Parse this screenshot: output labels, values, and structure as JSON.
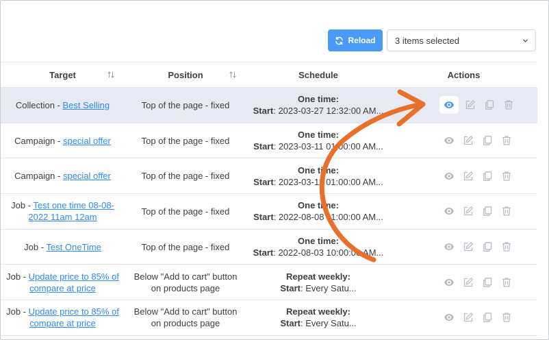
{
  "toolbar": {
    "reload_label": "Reload",
    "select_value": "3 items selected"
  },
  "columns": {
    "target": "Target",
    "position": "Position",
    "schedule": "Schedule",
    "actions": "Actions"
  },
  "rows": [
    {
      "prefix": "Collection - ",
      "link": "Best Selling",
      "position": "Top of the page - fixed",
      "sched_title": "One time:",
      "sched_key": "Start",
      "sched_val": ": 2023-03-27 12:32:00 AM...",
      "highlight": true
    },
    {
      "prefix": "Campaign - ",
      "link": "special offer",
      "position": "Top of the page - fixed",
      "sched_title": "One time:",
      "sched_key": "Start",
      "sched_val": ": 2023-03-11 01:00:00 AM..."
    },
    {
      "prefix": "Campaign - ",
      "link": "special offer",
      "position": "Top of the page - fixed",
      "sched_title": "One time:",
      "sched_key": "Start",
      "sched_val": ": 2023-03-11 01:00:00 AM..."
    },
    {
      "prefix": "Job - ",
      "link": "Test one time 08-08-2022 11am 12am",
      "position": "Top of the page - fixed",
      "sched_title": "One time:",
      "sched_key": "Start",
      "sched_val": ": 2022-08-08 11:00:00 AM..."
    },
    {
      "prefix": "Job - ",
      "link": "Test OneTime",
      "position": "Top of the page - fixed",
      "sched_title": "One time:",
      "sched_key": "Start",
      "sched_val": ": 2022-08-03 10:00:00 AM..."
    },
    {
      "prefix": "Job - ",
      "link": "Update price to 85% of compare at price",
      "position": "Below \"Add to cart\" button on products page",
      "sched_title": "Repeat weekly:",
      "sched_key": "Start",
      "sched_val": ": Every Satu..."
    },
    {
      "prefix": "Job - ",
      "link": "Update price to 85% of compare at price",
      "position": "Below \"Add to cart\" button on products page",
      "sched_title": "Repeat weekly:",
      "sched_key": "Start",
      "sched_val": ": Every Satu..."
    }
  ],
  "icons": {
    "reload": "refresh-icon",
    "dropdown": "chevron-down-icon",
    "sort": "sort-icon",
    "view": "eye-icon",
    "edit": "edit-icon",
    "duplicate": "copy-icon",
    "delete": "trash-icon"
  },
  "colors": {
    "accent": "#4a9bf7",
    "link": "#2f8af2",
    "highlight_row": "#e8eaf3",
    "arrow": "#e8702a",
    "icon_muted": "#b8bcc4"
  }
}
